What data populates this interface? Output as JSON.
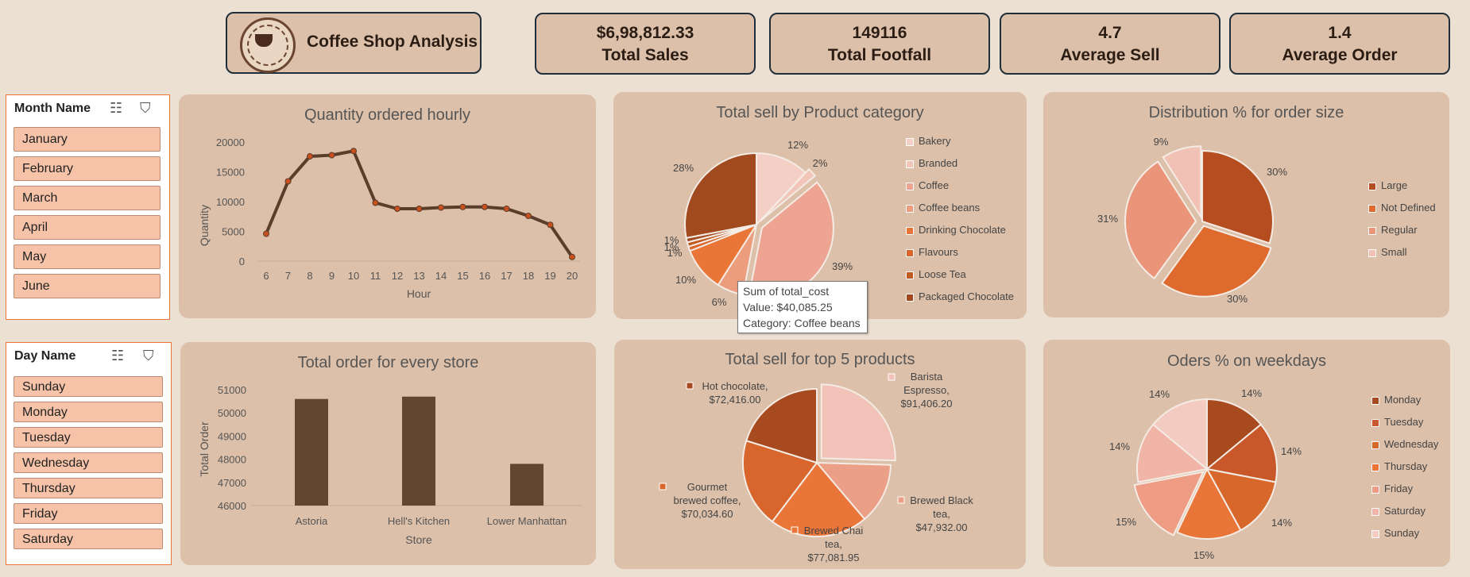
{
  "header": {
    "title": "Coffee Shop Analysis",
    "logo_text": "HOT COFFEE"
  },
  "kpis": [
    {
      "value": "$6,98,812.33",
      "label": "Total Sales"
    },
    {
      "value": "149116",
      "label": "Total Footfall"
    },
    {
      "value": "4.7",
      "label": "Average Sell"
    },
    {
      "value": "1.4",
      "label": "Average Order"
    }
  ],
  "month_slicer": {
    "header": "Month Name",
    "items": [
      "January",
      "February",
      "March",
      "April",
      "May",
      "June"
    ]
  },
  "day_slicer": {
    "header": "Day Name",
    "items": [
      "Sunday",
      "Monday",
      "Tuesday",
      "Wednesday",
      "Thursday",
      "Friday",
      "Saturday"
    ]
  },
  "tooltip": {
    "line1": "Sum of total_cost",
    "line2": "Value: $40,085.25",
    "line3": "Category: Coffee beans"
  },
  "colors": {
    "line": "#5a3d2b",
    "bar": "#624631",
    "panel": "#dcc0aa"
  },
  "chart_data": [
    {
      "type": "line",
      "title": "Quantity ordered hourly",
      "xlabel": "Hour",
      "ylabel": "Quantity",
      "x": [
        6,
        7,
        8,
        9,
        10,
        11,
        12,
        13,
        14,
        15,
        16,
        17,
        18,
        19,
        20
      ],
      "y": [
        4600,
        13400,
        17600,
        17800,
        18500,
        9800,
        8800,
        8800,
        9000,
        9100,
        9100,
        8800,
        7600,
        6100,
        700
      ],
      "ylim": [
        0,
        20000
      ],
      "yticks": [
        0,
        5000,
        10000,
        15000,
        20000
      ]
    },
    {
      "type": "pie",
      "title": "Total sell by Product category",
      "categories": [
        "Bakery",
        "Branded",
        "Coffee",
        "Coffee beans",
        "Drinking Chocolate",
        "Flavours",
        "Loose Tea",
        "Packaged Chocolate"
      ],
      "values": [
        12,
        2,
        39,
        6,
        10,
        1,
        1,
        1
      ],
      "labels": [
        "12%",
        "2%",
        "39%",
        "6%",
        "10%",
        "1%",
        "1%",
        "1%"
      ],
      "extra_label": "28%",
      "extra_value": 28
    },
    {
      "type": "pie",
      "title": "Distribution % for order size",
      "categories": [
        "Large",
        "Not Defined",
        "Regular",
        "Small"
      ],
      "values": [
        30,
        30,
        31,
        9
      ],
      "labels": [
        "30%",
        "30%",
        "31%",
        "9%"
      ]
    },
    {
      "type": "bar",
      "title": "Total order for every store",
      "categories": [
        "Astoria",
        "Hell's Kitchen",
        "Lower Manhattan"
      ],
      "values": [
        50600,
        50700,
        47800
      ],
      "xlabel": "Store",
      "ylabel": "Total Order",
      "ylim": [
        46000,
        51000
      ],
      "yticks": [
        46000,
        47000,
        48000,
        49000,
        50000,
        51000
      ]
    },
    {
      "type": "pie",
      "title": "Total sell for top 5 products",
      "categories": [
        "Barista Espresso",
        "Brewed Black tea",
        "Brewed Chai tea",
        "Gourmet brewed coffee",
        "Hot chocolate"
      ],
      "values": [
        91406.2,
        47932.0,
        77081.95,
        70034.6,
        72416.0
      ],
      "labels": [
        "Barista Espresso, $91,406.20",
        "Brewed Black tea, $47,932.00",
        "Brewed Chai tea, $77,081.95",
        "Gourmet brewed coffee, $70,034.60",
        "Hot chocolate, $72,416.00"
      ]
    },
    {
      "type": "pie",
      "title": "Oders % on weekdays",
      "categories": [
        "Monday",
        "Tuesday",
        "Wednesday",
        "Thursday",
        "Friday",
        "Saturday",
        "Sunday"
      ],
      "values": [
        14,
        14,
        14,
        15,
        15,
        14,
        14
      ],
      "labels": [
        "14%",
        "14%",
        "14%",
        "15%",
        "15%",
        "14%",
        "14%"
      ]
    }
  ]
}
